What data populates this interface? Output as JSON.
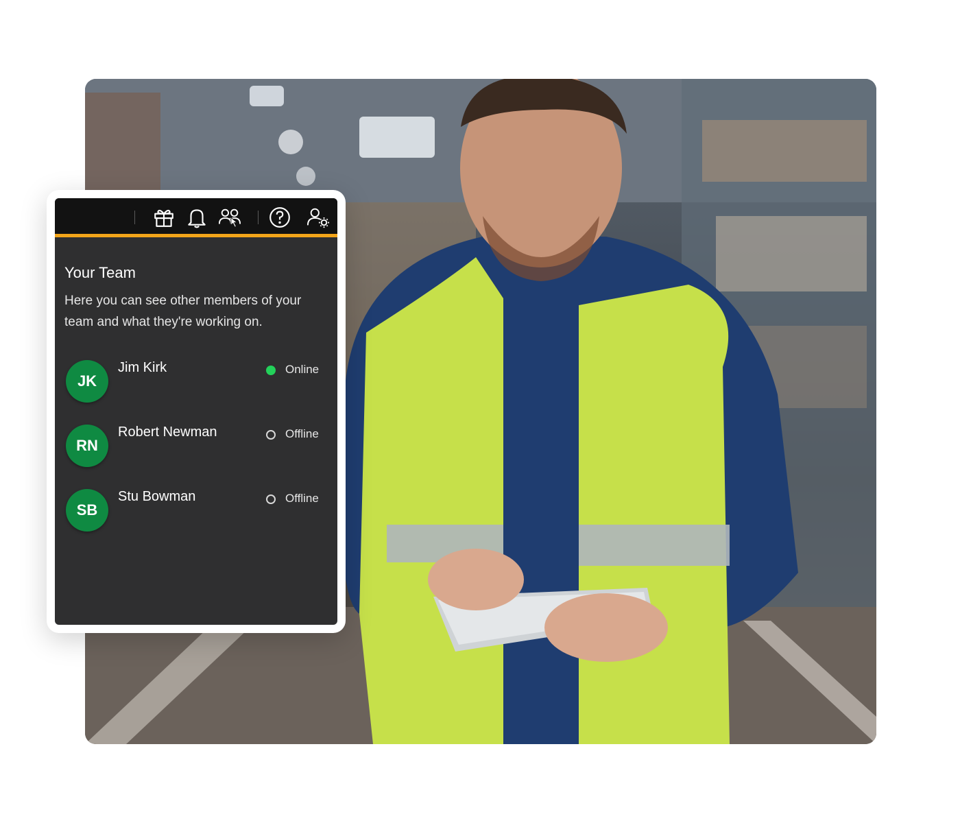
{
  "toolbar": {
    "icons": [
      "gift-icon",
      "bell-icon",
      "team-icon",
      "help-icon",
      "user-settings-icon"
    ],
    "accent": "#f2a51a"
  },
  "panel": {
    "title": "Your Team",
    "description": "Here you can see other members of your team and what they're working on."
  },
  "members": [
    {
      "initials": "JK",
      "name": "Jim Kirk",
      "status": "Online"
    },
    {
      "initials": "RN",
      "name": "Robert Newman",
      "status": "Offline"
    },
    {
      "initials": "SB",
      "name": "Stu Bowman",
      "status": "Offline"
    }
  ],
  "colors": {
    "avatar": "#0f8a42",
    "online": "#23d15a",
    "panel_bg": "#2f2f30",
    "toolbar_bg": "#121212"
  }
}
